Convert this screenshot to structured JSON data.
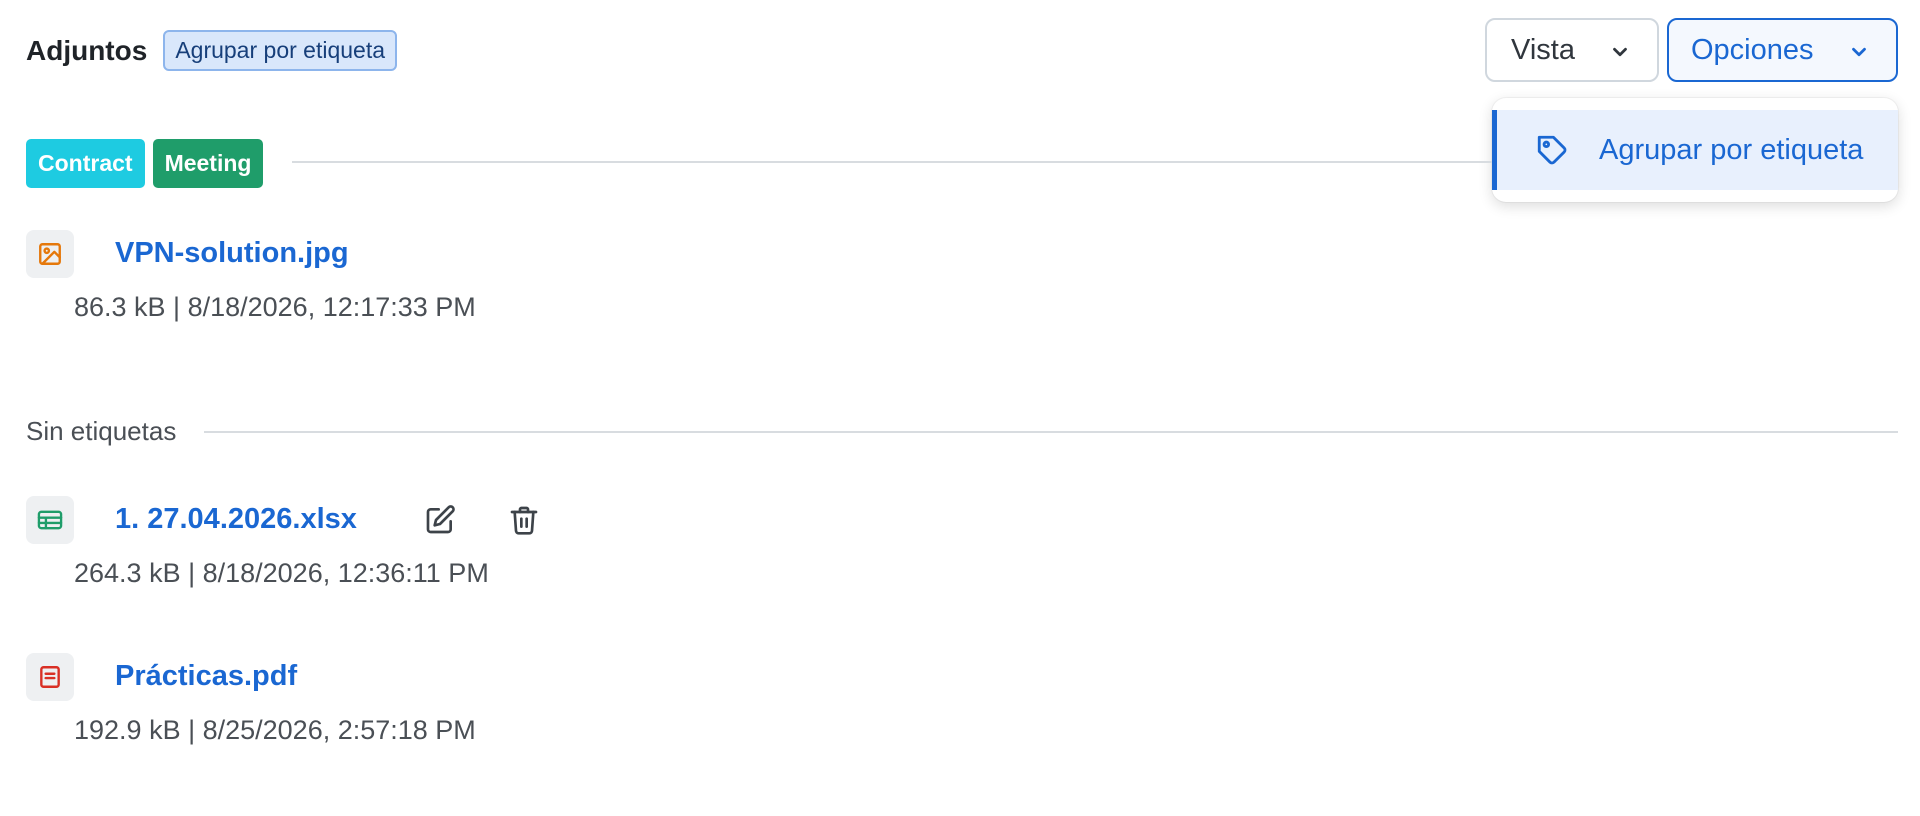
{
  "header": {
    "title": "Adjuntos",
    "active_grouping_chip": "Agrupar por etiqueta"
  },
  "toolbar": {
    "view_label": "Vista",
    "options_label": "Opciones"
  },
  "options_menu": {
    "items": [
      {
        "label": "Agrupar por etiqueta",
        "icon": "tag-icon",
        "selected": true
      }
    ]
  },
  "groups": [
    {
      "labels": [
        {
          "name": "Contract",
          "color": "#1ecbe1"
        },
        {
          "name": "Meeting",
          "color": "#1f9d6a"
        }
      ],
      "files": [
        {
          "name": "VPN-solution.jpg",
          "meta": "86.3 kB | 8/18/2026, 12:17:33 PM",
          "icon": "image-file-icon",
          "icon_color": "#e5780b"
        }
      ]
    },
    {
      "title": "Sin etiquetas",
      "files": [
        {
          "name": "1. 27.04.2026.xlsx",
          "meta": "264.3 kB | 8/18/2026, 12:36:11 PM",
          "icon": "spreadsheet-file-icon",
          "icon_color": "#1f9d6a",
          "actions": [
            "edit-icon",
            "trash-icon"
          ]
        },
        {
          "name": "Prácticas.pdf",
          "meta": "192.9 kB | 8/25/2026, 2:57:18 PM",
          "icon": "pdf-file-icon",
          "icon_color": "#d93025"
        }
      ]
    }
  ],
  "colors": {
    "accent": "#1a67d2",
    "text_muted": "#4a4f55"
  }
}
